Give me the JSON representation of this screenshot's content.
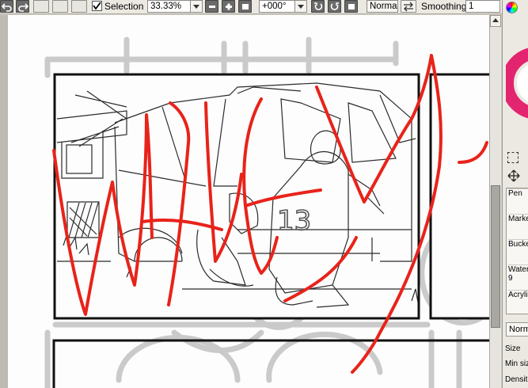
{
  "toolbar": {
    "selection_label": "Selection",
    "selection_checked": true,
    "zoom_value": "33.33%",
    "rotation_value": "+000°",
    "blend_mode": "Normal",
    "smoothing_label": "Smoothing",
    "smoothing_value": "1"
  },
  "tool_panel": {
    "tools": [
      {
        "label": "Pen",
        "value": ""
      },
      {
        "label": "Marke",
        "value": ""
      },
      {
        "label": "Bucke",
        "value": ""
      },
      {
        "label": "Water",
        "value": "9"
      },
      {
        "label": "Acryli",
        "value": ""
      }
    ],
    "mode_value": "Norm",
    "size_label": "Size",
    "min_size_label": "Min siz",
    "density_label": "Densit"
  },
  "colors": {
    "stroke_red": "#e8231a",
    "line_gray": "#9a9a9a"
  },
  "icons": [
    "undo-icon",
    "redo-icon",
    "minus-icon",
    "plus-icon",
    "reset-icon",
    "rotate-ccw-icon",
    "rotate-cw-icon",
    "flip-icon",
    "color-wheel-icon",
    "select-rect-icon",
    "move-icon",
    "chevron-down-icon"
  ]
}
